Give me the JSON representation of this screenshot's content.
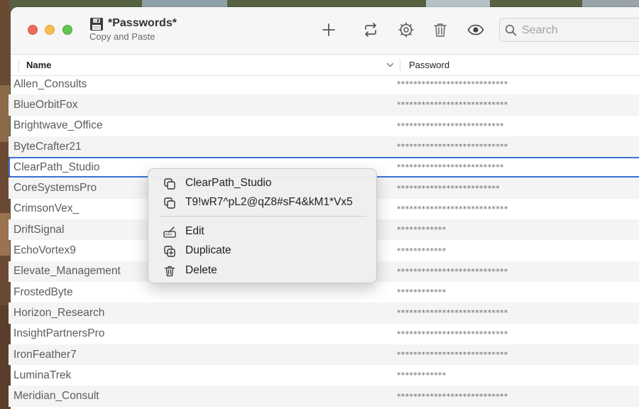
{
  "window": {
    "title": "*Passwords*",
    "subtitle": "Copy and Paste"
  },
  "toolbar": {
    "buttons": [
      {
        "icon": "plus-icon"
      },
      {
        "icon": "sync-icon"
      },
      {
        "icon": "gear-icon"
      },
      {
        "icon": "trash-icon"
      },
      {
        "icon": "eye-icon"
      }
    ],
    "search_placeholder": "Search"
  },
  "table": {
    "columns": [
      "Name",
      "Password"
    ],
    "rows": [
      {
        "name": "Allen_Consults",
        "password": "***************************"
      },
      {
        "name": "BlueOrbitFox",
        "password": "***************************"
      },
      {
        "name": "Brightwave_Office",
        "password": "**************************"
      },
      {
        "name": "ByteCrafter21",
        "password": "***************************"
      },
      {
        "name": "ClearPath_Studio",
        "password": "**************************",
        "selected": true
      },
      {
        "name": "CoreSystemsPro",
        "password": "*************************"
      },
      {
        "name": "CrimsonVex_",
        "password": "***************************"
      },
      {
        "name": "DriftSignal",
        "password": "************"
      },
      {
        "name": "EchoVortex9",
        "password": "************"
      },
      {
        "name": "Elevate_Management",
        "password": "***************************"
      },
      {
        "name": "FrostedByte",
        "password": "************"
      },
      {
        "name": "Horizon_Research",
        "password": "***************************"
      },
      {
        "name": "InsightPartnersPro",
        "password": "***************************"
      },
      {
        "name": "IronFeather7",
        "password": "***************************"
      },
      {
        "name": "LuminaTrek",
        "password": "************"
      },
      {
        "name": "Meridian_Consult",
        "password": "***************************"
      }
    ]
  },
  "context_menu": {
    "copy_name": "ClearPath_Studio",
    "copy_password": "T9!wR7^pL2@qZ8#sF4&kM1*Vx5",
    "edit": "Edit",
    "duplicate": "Duplicate",
    "delete": "Delete"
  },
  "colors": {
    "selection": "#3a72d6",
    "close": "#ed6a5e",
    "minimize": "#f5bf4f",
    "maximize": "#61c554"
  }
}
